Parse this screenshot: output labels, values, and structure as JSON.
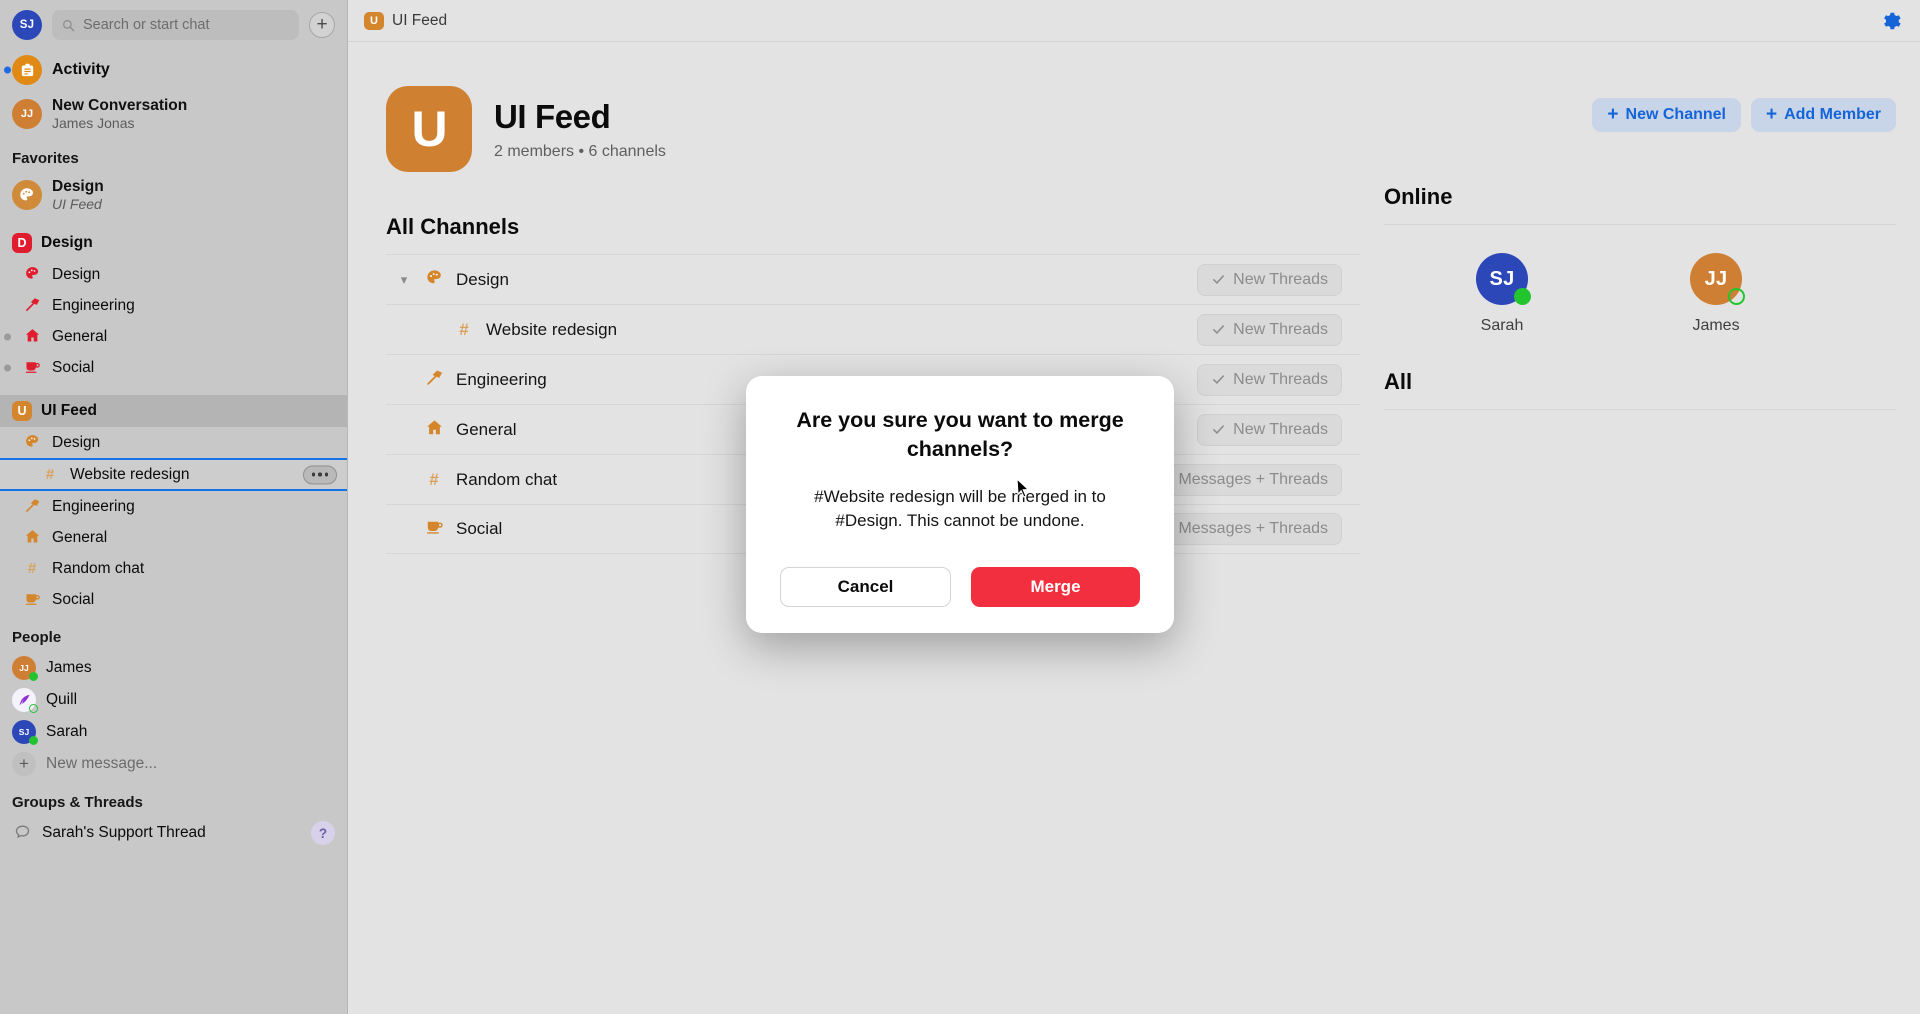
{
  "sidebar": {
    "user_initials": "SJ",
    "search": {
      "placeholder": "Search or start chat",
      "icon": "search-icon"
    },
    "new_chat_icon": "plus-icon",
    "activity": {
      "label": "Activity",
      "icon": "activity-icon"
    },
    "new_conversation": {
      "title": "New Conversation",
      "subtitle": "James Jonas",
      "initials": "JJ"
    },
    "favorites_header": "Favorites",
    "favorite": {
      "title": "Design",
      "subtitle": "UI Feed",
      "icon": "palette-icon"
    },
    "workspaces": [
      {
        "name": "Design",
        "badge": "D",
        "badge_color": "#e01d2e",
        "active": false,
        "channels": [
          {
            "label": "Design",
            "icon": "palette-icon",
            "muted": false,
            "nested": false
          },
          {
            "label": "Engineering",
            "icon": "hammer-icon",
            "muted": false,
            "nested": false
          },
          {
            "label": "General",
            "icon": "house-icon",
            "muted": true,
            "nested": false
          },
          {
            "label": "Social",
            "icon": "coffee-icon",
            "muted": true,
            "nested": false
          }
        ]
      },
      {
        "name": "UI Feed",
        "badge": "U",
        "badge_color": "#d4862c",
        "active": true,
        "channels": [
          {
            "label": "Design",
            "icon": "palette-icon",
            "nested": false,
            "selected": false
          },
          {
            "label": "Website redesign",
            "icon": "hash-icon",
            "nested": true,
            "selected": true,
            "more_icon": "more-options-icon"
          },
          {
            "label": "Engineering",
            "icon": "hammer-icon",
            "nested": false,
            "selected": false
          },
          {
            "label": "General",
            "icon": "house-icon",
            "nested": false,
            "selected": false
          },
          {
            "label": "Random chat",
            "icon": "hash-icon",
            "nested": false,
            "selected": false
          },
          {
            "label": "Social",
            "icon": "coffee-icon",
            "nested": false,
            "selected": false
          }
        ]
      }
    ],
    "people_header": "People",
    "people": [
      {
        "name": "James",
        "initials": "JJ",
        "color": "#cf7f34",
        "presence": "on"
      },
      {
        "name": "Quill",
        "initials": "",
        "color": "#f4f2fa",
        "presence": "idle"
      },
      {
        "name": "Sarah",
        "initials": "SJ",
        "color": "#2b47b8",
        "presence": "on"
      }
    ],
    "new_message": {
      "label": "New message...",
      "icon": "plus-icon"
    },
    "groups_header": "Groups & Threads",
    "threads": [
      {
        "label": "Sarah's Support Thread",
        "icon": "chat-bubble-icon",
        "badge": "?"
      }
    ]
  },
  "topbar": {
    "breadcrumb": "UI Feed",
    "breadcrumb_badge": "U",
    "settings_icon": "gear-icon"
  },
  "workspace": {
    "logo_letter": "U",
    "title": "UI Feed",
    "subtitle": "2 members • 6 channels",
    "new_channel_label": "New Channel",
    "add_member_label": "Add Member"
  },
  "channels_panel": {
    "title": "All Channels",
    "rows": [
      {
        "label": "Design",
        "icon": "palette-icon",
        "nested": false,
        "expandable": true,
        "chevron": "chevron-down-icon",
        "action": "New Threads",
        "action_icon": "check-icon"
      },
      {
        "label": "Website redesign",
        "icon": "hash-icon",
        "nested": true,
        "expandable": false,
        "chevron": "",
        "action": "New Threads",
        "action_icon": "check-icon"
      },
      {
        "label": "Engineering",
        "icon": "hammer-icon",
        "nested": false,
        "expandable": false,
        "chevron": "",
        "action": "New Threads",
        "action_icon": "check-icon"
      },
      {
        "label": "General",
        "icon": "house-icon",
        "nested": false,
        "expandable": false,
        "chevron": "",
        "action": "New Threads",
        "action_icon": "check-icon"
      },
      {
        "label": "Random chat",
        "icon": "hash-icon",
        "nested": false,
        "expandable": false,
        "chevron": "",
        "action": "Messages + Threads",
        "action_icon": "check-icon"
      },
      {
        "label": "Social",
        "icon": "coffee-icon",
        "nested": false,
        "expandable": false,
        "chevron": "",
        "action": "Messages + Threads",
        "action_icon": "check-icon"
      }
    ]
  },
  "members_panel": {
    "online_title": "Online",
    "all_title": "All",
    "online": [
      {
        "name": "Sarah",
        "initials": "SJ",
        "color": "#2b47b8",
        "presence": "on"
      },
      {
        "name": "James",
        "initials": "JJ",
        "color": "#cf7f34",
        "presence": "idle"
      }
    ]
  },
  "dialog": {
    "title": "Are you sure you want to merge channels?",
    "body": "#Website redesign will be merged in to #Design. This cannot be undone.",
    "cancel_label": "Cancel",
    "confirm_label": "Merge",
    "confirm_color": "#f22f3e"
  }
}
